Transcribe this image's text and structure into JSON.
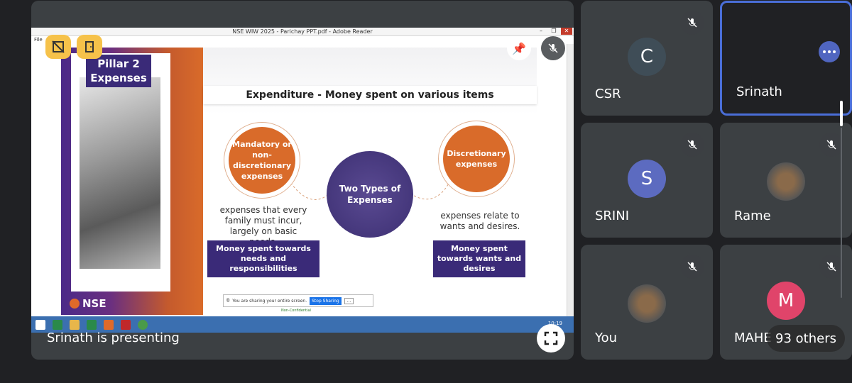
{
  "window": {
    "title": "NSE WIW 2025 - Parichay PPT.pdf - Adobe Reader",
    "menu": "File"
  },
  "slide": {
    "pillar_line1": "Pillar 2",
    "pillar_line2": "Expenses",
    "heading": "Expenditure - Money spent on various items",
    "left_circle": "Mandatory or non-discretionary expenses",
    "right_circle": "Discretionary expenses",
    "center_circle": "Two Types of Expenses",
    "left_desc": "expenses that every family must incur, largely on basic needs.",
    "right_desc": "expenses relate to wants and desires.",
    "left_box": "Money spent towards needs and responsibilities",
    "right_box": "Money spent towards wants and desires",
    "logo": "NSE",
    "footer": "Non-Confidential"
  },
  "share_bar": {
    "message": "You are sharing your entire screen.",
    "stop_label": "Stop Sharing",
    "more_label": "..."
  },
  "taskbar": {
    "clock": "10:19"
  },
  "presenter_text": "Srinath is presenting",
  "participants": [
    {
      "name": "CSR",
      "initial": "C",
      "color": "#3f4d57"
    },
    {
      "name": "Srinath",
      "initial": "",
      "color": "#202124"
    },
    {
      "name": "SRINI",
      "initial": "S",
      "color": "#5c6bc0"
    },
    {
      "name": "Rame",
      "initial": "",
      "color": ""
    },
    {
      "name": "You",
      "initial": "",
      "color": ""
    },
    {
      "name": "MAHE",
      "initial": "M",
      "color": "#e0446a"
    }
  ],
  "others_label": "93 others"
}
